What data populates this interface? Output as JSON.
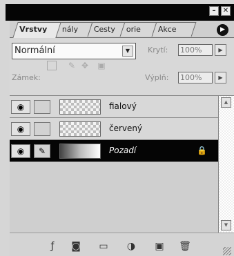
{
  "window": {
    "minimize_label": "–",
    "close_label": "✕"
  },
  "tabs": [
    {
      "label": "Vrstvy",
      "active": true
    },
    {
      "label": "nály",
      "active": false
    },
    {
      "label": "Cesty",
      "active": false
    },
    {
      "label": "orie",
      "active": false
    },
    {
      "label": "Akce",
      "active": false
    }
  ],
  "options": {
    "blend_mode": "Normální",
    "opacity_label": "Krytí:",
    "opacity_value": "100%",
    "lock_label": "Zámek:",
    "fill_label": "Výplň:",
    "fill_value": "100%"
  },
  "layers": [
    {
      "name": "fialový",
      "visible": true,
      "selected": false,
      "locked": false,
      "italic": false
    },
    {
      "name": "červený",
      "visible": true,
      "selected": false,
      "locked": false,
      "italic": false
    },
    {
      "name": "Pozadí",
      "visible": true,
      "selected": true,
      "locked": true,
      "italic": true
    }
  ],
  "icons": {
    "eye": "eye-icon",
    "brush": "brush-icon",
    "lock": "lock-icon",
    "move": "move-icon",
    "transparency_lock": "transparency-lock-icon",
    "layer_style": "layer-style-icon",
    "mask": "layer-mask-icon",
    "folder": "new-set-icon",
    "adjustment": "adjustment-layer-icon",
    "new_layer": "new-layer-icon",
    "trash": "trash-icon",
    "panel_menu": "panel-menu-icon"
  },
  "colors": {
    "panel_bg": "#d6d6d6",
    "selected_bg": "#050505",
    "selected_text": "#ffffff"
  }
}
